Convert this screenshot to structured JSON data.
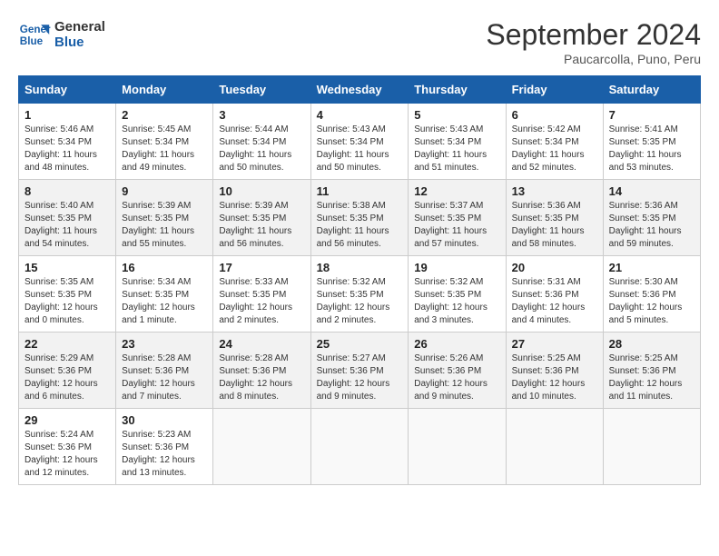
{
  "logo": {
    "line1": "General",
    "line2": "Blue"
  },
  "title": "September 2024",
  "location": "Paucarcolla, Puno, Peru",
  "weekdays": [
    "Sunday",
    "Monday",
    "Tuesday",
    "Wednesday",
    "Thursday",
    "Friday",
    "Saturday"
  ],
  "weeks": [
    [
      {
        "day": "1",
        "text": "Sunrise: 5:46 AM\nSunset: 5:34 PM\nDaylight: 11 hours\nand 48 minutes."
      },
      {
        "day": "2",
        "text": "Sunrise: 5:45 AM\nSunset: 5:34 PM\nDaylight: 11 hours\nand 49 minutes."
      },
      {
        "day": "3",
        "text": "Sunrise: 5:44 AM\nSunset: 5:34 PM\nDaylight: 11 hours\nand 50 minutes."
      },
      {
        "day": "4",
        "text": "Sunrise: 5:43 AM\nSunset: 5:34 PM\nDaylight: 11 hours\nand 50 minutes."
      },
      {
        "day": "5",
        "text": "Sunrise: 5:43 AM\nSunset: 5:34 PM\nDaylight: 11 hours\nand 51 minutes."
      },
      {
        "day": "6",
        "text": "Sunrise: 5:42 AM\nSunset: 5:34 PM\nDaylight: 11 hours\nand 52 minutes."
      },
      {
        "day": "7",
        "text": "Sunrise: 5:41 AM\nSunset: 5:35 PM\nDaylight: 11 hours\nand 53 minutes."
      }
    ],
    [
      {
        "day": "8",
        "text": "Sunrise: 5:40 AM\nSunset: 5:35 PM\nDaylight: 11 hours\nand 54 minutes."
      },
      {
        "day": "9",
        "text": "Sunrise: 5:39 AM\nSunset: 5:35 PM\nDaylight: 11 hours\nand 55 minutes."
      },
      {
        "day": "10",
        "text": "Sunrise: 5:39 AM\nSunset: 5:35 PM\nDaylight: 11 hours\nand 56 minutes."
      },
      {
        "day": "11",
        "text": "Sunrise: 5:38 AM\nSunset: 5:35 PM\nDaylight: 11 hours\nand 56 minutes."
      },
      {
        "day": "12",
        "text": "Sunrise: 5:37 AM\nSunset: 5:35 PM\nDaylight: 11 hours\nand 57 minutes."
      },
      {
        "day": "13",
        "text": "Sunrise: 5:36 AM\nSunset: 5:35 PM\nDaylight: 11 hours\nand 58 minutes."
      },
      {
        "day": "14",
        "text": "Sunrise: 5:36 AM\nSunset: 5:35 PM\nDaylight: 11 hours\nand 59 minutes."
      }
    ],
    [
      {
        "day": "15",
        "text": "Sunrise: 5:35 AM\nSunset: 5:35 PM\nDaylight: 12 hours\nand 0 minutes."
      },
      {
        "day": "16",
        "text": "Sunrise: 5:34 AM\nSunset: 5:35 PM\nDaylight: 12 hours\nand 1 minute."
      },
      {
        "day": "17",
        "text": "Sunrise: 5:33 AM\nSunset: 5:35 PM\nDaylight: 12 hours\nand 2 minutes."
      },
      {
        "day": "18",
        "text": "Sunrise: 5:32 AM\nSunset: 5:35 PM\nDaylight: 12 hours\nand 2 minutes."
      },
      {
        "day": "19",
        "text": "Sunrise: 5:32 AM\nSunset: 5:35 PM\nDaylight: 12 hours\nand 3 minutes."
      },
      {
        "day": "20",
        "text": "Sunrise: 5:31 AM\nSunset: 5:36 PM\nDaylight: 12 hours\nand 4 minutes."
      },
      {
        "day": "21",
        "text": "Sunrise: 5:30 AM\nSunset: 5:36 PM\nDaylight: 12 hours\nand 5 minutes."
      }
    ],
    [
      {
        "day": "22",
        "text": "Sunrise: 5:29 AM\nSunset: 5:36 PM\nDaylight: 12 hours\nand 6 minutes."
      },
      {
        "day": "23",
        "text": "Sunrise: 5:28 AM\nSunset: 5:36 PM\nDaylight: 12 hours\nand 7 minutes."
      },
      {
        "day": "24",
        "text": "Sunrise: 5:28 AM\nSunset: 5:36 PM\nDaylight: 12 hours\nand 8 minutes."
      },
      {
        "day": "25",
        "text": "Sunrise: 5:27 AM\nSunset: 5:36 PM\nDaylight: 12 hours\nand 9 minutes."
      },
      {
        "day": "26",
        "text": "Sunrise: 5:26 AM\nSunset: 5:36 PM\nDaylight: 12 hours\nand 9 minutes."
      },
      {
        "day": "27",
        "text": "Sunrise: 5:25 AM\nSunset: 5:36 PM\nDaylight: 12 hours\nand 10 minutes."
      },
      {
        "day": "28",
        "text": "Sunrise: 5:25 AM\nSunset: 5:36 PM\nDaylight: 12 hours\nand 11 minutes."
      }
    ],
    [
      {
        "day": "29",
        "text": "Sunrise: 5:24 AM\nSunset: 5:36 PM\nDaylight: 12 hours\nand 12 minutes."
      },
      {
        "day": "30",
        "text": "Sunrise: 5:23 AM\nSunset: 5:36 PM\nDaylight: 12 hours\nand 13 minutes."
      },
      {
        "day": "",
        "text": ""
      },
      {
        "day": "",
        "text": ""
      },
      {
        "day": "",
        "text": ""
      },
      {
        "day": "",
        "text": ""
      },
      {
        "day": "",
        "text": ""
      }
    ]
  ]
}
